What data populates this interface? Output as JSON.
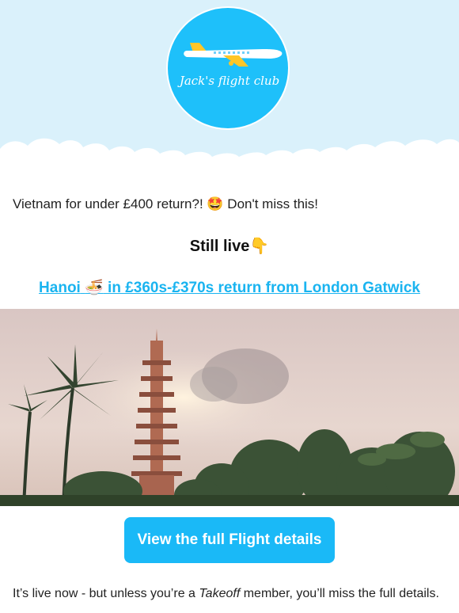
{
  "brand": {
    "name": "Jack's flight club",
    "accent": "#1ec0fa"
  },
  "intro": {
    "text": "Vietnam for under £400 return?! ",
    "emoji": "🤩",
    "cta_text": " Don't miss this!"
  },
  "still_live": {
    "label": "Still live",
    "emoji": "👇"
  },
  "deal": {
    "city": "Hanoi",
    "emoji": "🍜",
    "text": " in £360s-£370s return from London Gatwick"
  },
  "photo": {
    "alt_subject": "pagoda-and-palms"
  },
  "cta_button": {
    "label": "View the full Flight details",
    "color": "#1ab9f7"
  },
  "footer": {
    "before": "It’s live now - but unless you’re a ",
    "member_type": "Takeoff",
    "after": "  member, you’ll miss the full details."
  }
}
